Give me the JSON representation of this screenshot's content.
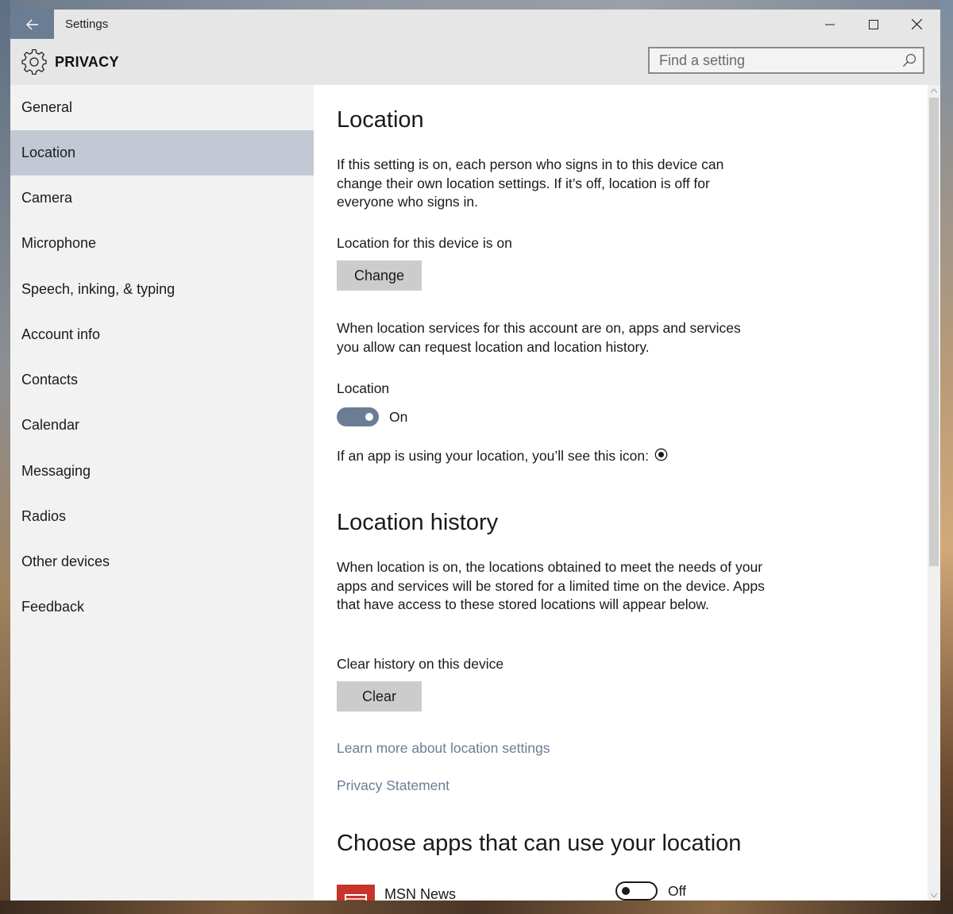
{
  "window": {
    "title": "Settings",
    "header_title": "PRIVACY",
    "controls": [
      "minimize-icon",
      "maximize-icon",
      "close-icon"
    ]
  },
  "search": {
    "placeholder": "Find a setting",
    "value": ""
  },
  "sidebar": {
    "items": [
      {
        "label": "General"
      },
      {
        "label": "Location",
        "active": true
      },
      {
        "label": "Camera"
      },
      {
        "label": "Microphone"
      },
      {
        "label": "Speech, inking, & typing"
      },
      {
        "label": "Account info"
      },
      {
        "label": "Contacts"
      },
      {
        "label": "Calendar"
      },
      {
        "label": "Messaging"
      },
      {
        "label": "Radios"
      },
      {
        "label": "Other devices"
      },
      {
        "label": "Feedback"
      }
    ]
  },
  "content": {
    "location_title": "Location",
    "location_intro": "If this setting is on, each person who signs in to this device can change their own location settings. If it’s off, location is off for everyone who signs in.",
    "device_status": "Location for this device is on",
    "change_button": "Change",
    "services_text": "When location services for this account are on, apps and services you allow can request location and location history.",
    "location_toggle_label": "Location",
    "location_toggle_state": "On",
    "icon_note": "If an app is using your location, you’ll see this icon:",
    "history_title": "Location history",
    "history_text": "When location is on, the locations obtained to meet the needs of your apps and services will be stored for a limited time on the device. Apps that have access to these stored locations will appear below.",
    "clear_label": "Clear history on this device",
    "clear_button": "Clear",
    "learn_more_link": "Learn more about location settings",
    "privacy_link": "Privacy Statement",
    "apps_title": "Choose apps that can use your location",
    "apps": [
      {
        "name": "MSN News",
        "state": "Off",
        "icon": "msn-news-icon"
      }
    ]
  },
  "colors": {
    "accent": "#6b7d95",
    "active_nav": "#c3c9d4",
    "sidebar_bg": "#f2f2f2",
    "header_bg": "#e6e6e6",
    "button_bg": "#cccccc",
    "msn_red": "#c8332c"
  }
}
